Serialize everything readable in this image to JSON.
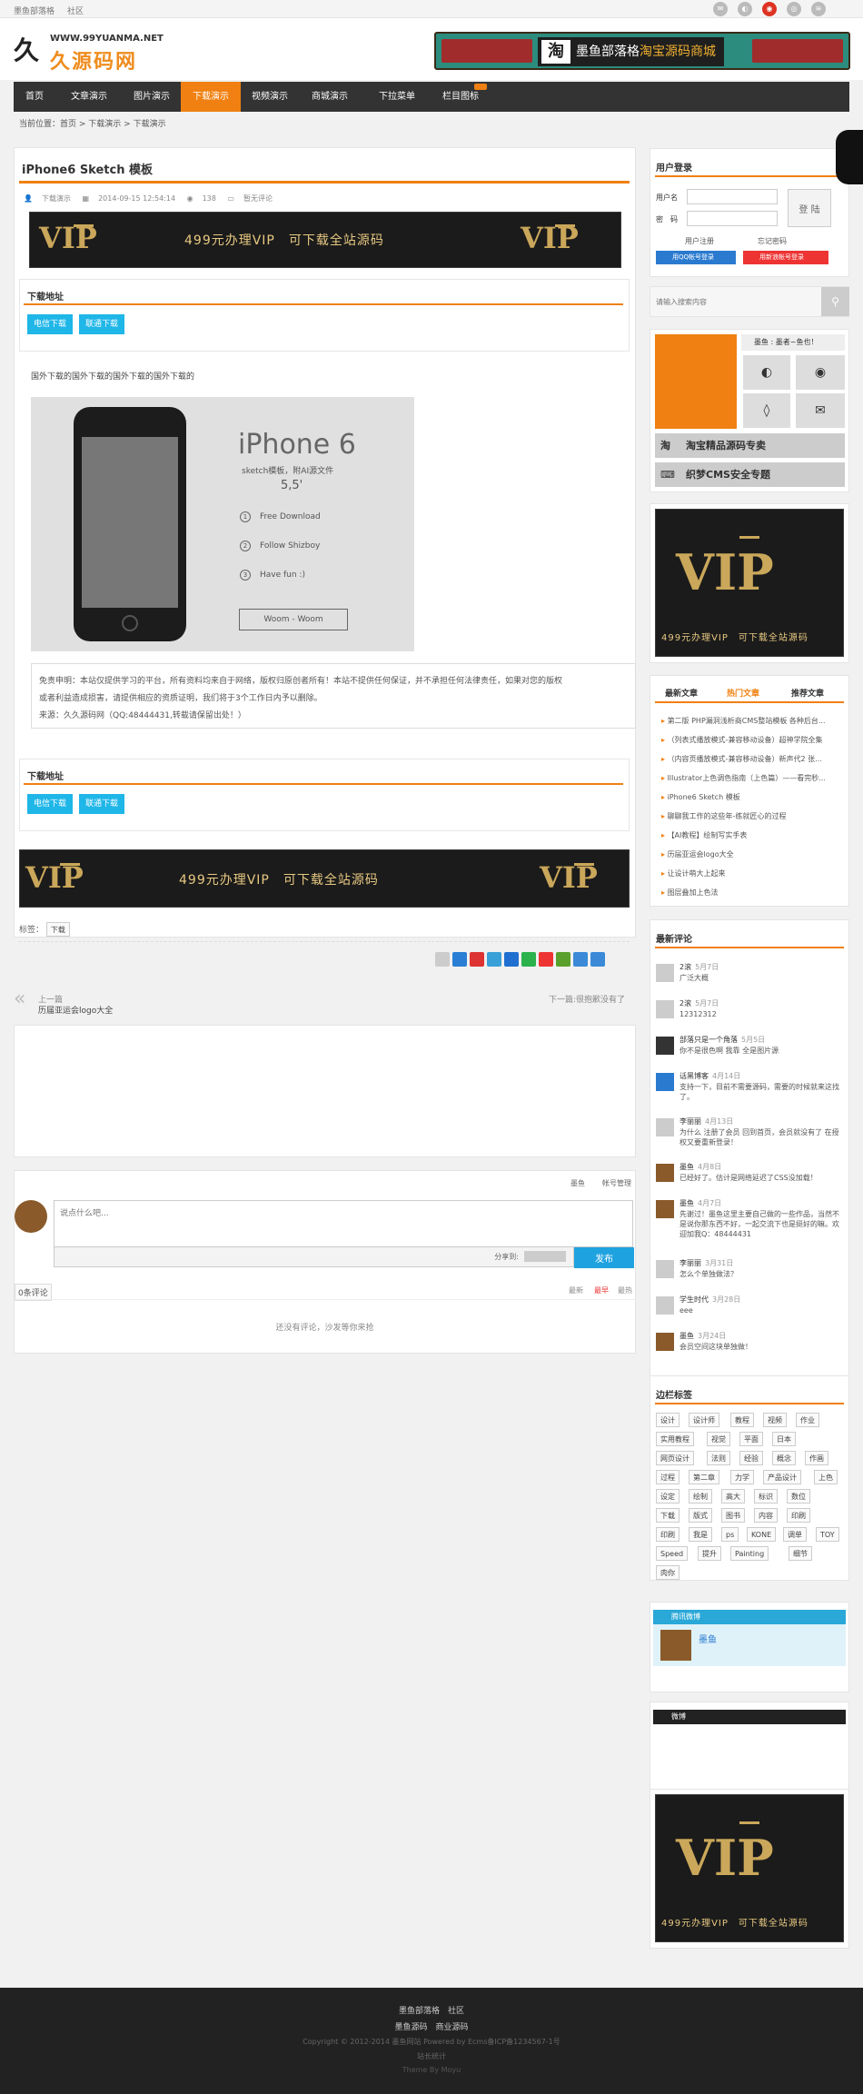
{
  "topbar": {
    "links": [
      "墨鱼部落格",
      "社区"
    ],
    "social_icons": [
      "weixin-icon",
      "qq-icon",
      "weibo-icon",
      "tencent-weibo-icon",
      "rss-icon"
    ]
  },
  "header": {
    "logo_mark": "久",
    "logo_url": "WWW.99YUANMA.NET",
    "logo_name": "久源码网",
    "banner": {
      "mark": "淘",
      "text": "墨鱼部落格",
      "highlight": "淘宝源码商城"
    }
  },
  "nav": {
    "items": [
      "首页",
      "文章演示",
      "图片演示",
      "下载演示",
      "视频演示",
      "商城演示",
      "下拉菜单",
      "栏目图标"
    ],
    "active_index": 3
  },
  "breadcrumb": {
    "label": "当前位置：",
    "parts": [
      "首页",
      " > ",
      "下载演示",
      " > ",
      "下载演示"
    ]
  },
  "article": {
    "title": "iPhone6 Sketch 模板",
    "meta": {
      "category": "下载演示",
      "date": "2014-09-15 12:54:14",
      "views": "138",
      "comments": "暂无评论"
    },
    "vip_banner": {
      "left": "VIP",
      "text": "499元办理VIP　可下载全站源码",
      "right": "VIP"
    },
    "download": {
      "heading": "下载地址",
      "buttons": [
        "电信下载",
        "联通下载"
      ]
    },
    "body_text": "国外下载的国外下载的国外下载的国外下载的",
    "phone_image": {
      "title": "iPhone 6",
      "subtitle": "sketch模板，附AI源文件",
      "size": "5,5'",
      "steps": [
        "Free Download",
        "Follow Shizboy",
        "Have fun :)"
      ],
      "step_numbers": [
        "1",
        "2",
        "3"
      ],
      "button": "Woom - Woom"
    },
    "disclaimer": [
      "免责申明：本站仅提供学习的平台，所有资料均来自于网络，版权归原创者所有！本站不提供任何保证，并不承担任何法律责任，如果对您的版权",
      "或者利益造成损害，请提供相应的资质证明，我们将于3个工作日内予以删除。",
      "来源：久久源码网（QQ:48444431,转载请保留出处！）"
    ],
    "tags_label": "标签：",
    "tags": [
      "下载"
    ]
  },
  "pager": {
    "prev_label": "上一篇",
    "prev_title": "历届亚运会logo大全",
    "next": "下一篇:很抱歉没有了"
  },
  "comment": {
    "top_links": [
      "墨鱼",
      "帐号管理"
    ],
    "placeholder": "说点什么吧...",
    "share_label": "分享到:",
    "submit": "发布",
    "count": "0条评论",
    "sort": [
      "最新",
      "最早",
      "最热"
    ],
    "empty": "还没有评论，沙发等你来抢"
  },
  "sidebar": {
    "login": {
      "heading": "用户登录",
      "user_label": "用户名",
      "pass_label": "密　码",
      "login_btn": "登 陆",
      "register": "用户注册",
      "forgot": "忘记密码",
      "qq_login": "用QQ帐号登录",
      "weibo_login": "用新浪帐号登录"
    },
    "search": {
      "placeholder": "请输入搜索内容"
    },
    "profile": {
      "name": "墨鱼 : 墨者~鱼也！",
      "links": [
        "淘宝精品源码专卖",
        "织梦CMS安全专题"
      ],
      "link_marks": [
        "淘",
        "⌨"
      ]
    },
    "vip": {
      "v": "VIP",
      "text": "499元办理VIP　可下载全站源码"
    },
    "tabs": {
      "labels": [
        "最新文章",
        "热门文章",
        "推荐文章"
      ],
      "active_index": 1,
      "items": [
        "第二版 PHP漏洞浅析商CMS整站模板 各种后台...",
        "（列表式播放模式-兼容移动设备）超神学院全集",
        "（内容页播放模式-兼容移动设备）新声代2 张...",
        "Illustrator上色调色指南（上色篇）——看完秒...",
        "iPhone6 Sketch 模板",
        "聊聊我工作的这些年-练就匠心的过程",
        "【AI教程】绘制写实手表",
        "历届亚运会logo大全",
        "让设计萌大上起来",
        "图层叠加上色法"
      ]
    },
    "comments": {
      "heading": "最新评论",
      "items": [
        {
          "name": "2滚",
          "date": "5月7日",
          "text": "广泛大概"
        },
        {
          "name": "2滚",
          "date": "5月7日",
          "text": "12312312"
        },
        {
          "name": "部落只是一个角落",
          "date": "5月5日",
          "text": "你不是很色啊 我靠 全是图片源"
        },
        {
          "name": "话黑博客",
          "date": "4月14日",
          "text": "支持一下，目前不需要源码，需要的时候就来这找了。"
        },
        {
          "name": "李丽丽",
          "date": "4月13日",
          "text": "为什么 注册了会员 回到首页，会员就没有了 在授权又要重新登录！"
        },
        {
          "name": "墨鱼",
          "date": "4月8日",
          "text": "已经好了。估计是网络延迟了CSS没加载！"
        },
        {
          "name": "墨鱼",
          "date": "4月7日",
          "text": "先谢过！墨鱼这里主要自己做的一些作品，当然不是说你那东西不好，一起交流下也是挺好的嘛。欢迎加我Q：48444431"
        },
        {
          "name": "李丽丽",
          "date": "3月31日",
          "text": "怎么个单独做法？"
        },
        {
          "name": "学生时代",
          "date": "3月28日",
          "text": "eee"
        },
        {
          "name": "墨鱼",
          "date": "3月24日",
          "text": "会员空间这块单独做！"
        }
      ]
    },
    "tags": {
      "heading": "边栏标签",
      "items": [
        "设计",
        "设计师",
        "教程",
        "视频",
        "作业",
        "实用教程",
        "视觉",
        "平面",
        "日本",
        "网页设计",
        "法则",
        "经验",
        "概念",
        "作画",
        "过程",
        "第二章",
        "力学",
        "产品设计",
        "上色",
        "设定",
        "绘制",
        "高大",
        "标识",
        "数位",
        "下载",
        "版式",
        "图书",
        "内容",
        "印刷",
        "印刷",
        "我是",
        "ps",
        "KONE",
        "调单",
        "TOY",
        "Speed",
        "提升",
        "Painting",
        "细节",
        "肉你"
      ]
    },
    "tweibo": {
      "heading": "腾讯微博",
      "name": "墨鱼"
    },
    "weibo": {
      "heading": "微博"
    }
  },
  "footer": {
    "links": [
      "墨鱼部落格",
      "社区"
    ],
    "links2": [
      "墨鱼源码",
      "商业源码"
    ],
    "copyright": "Copyright © 2012-2014 墨鱼网站 Powered by Ecms备ICP备1234567-1号",
    "stats": "站长统计",
    "theme": "Theme By Moyu"
  },
  "colors": {
    "accent": "#f08011",
    "nav": "#333333",
    "button": "#1fb6e8"
  }
}
